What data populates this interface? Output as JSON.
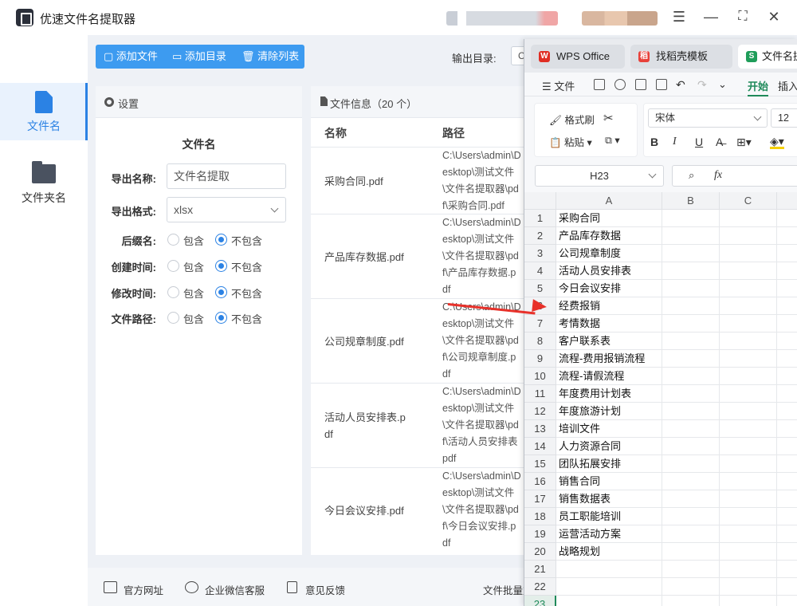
{
  "app": {
    "title": "优速文件名提取器"
  },
  "sidebar": {
    "items": [
      {
        "label": "文件名"
      },
      {
        "label": "文件夹名"
      }
    ]
  },
  "toolbar": {
    "add_file": "添加文件",
    "add_dir": "添加目录",
    "clear_list": "清除列表",
    "output_dir_label": "输出目录:",
    "output_dir_value": "C"
  },
  "settings": {
    "header": "设置",
    "section_title": "文件名",
    "export_name_label": "导出名称:",
    "export_name_value": "文件名提取",
    "export_format_label": "导出格式:",
    "export_format_value": "xlsx",
    "options": [
      {
        "label": "后缀名:",
        "include": "包含",
        "exclude": "不包含",
        "selected": "exclude"
      },
      {
        "label": "创建时间:",
        "include": "包含",
        "exclude": "不包含",
        "selected": "exclude"
      },
      {
        "label": "修改时间:",
        "include": "包含",
        "exclude": "不包含",
        "selected": "exclude"
      },
      {
        "label": "文件路径:",
        "include": "包含",
        "exclude": "不包含",
        "selected": "exclude"
      }
    ]
  },
  "file_info": {
    "header": "文件信息（20 个）",
    "col_name": "名称",
    "col_path": "路径",
    "rows": [
      {
        "name": [
          "采购合同.pdf"
        ],
        "path": [
          "C:\\Users\\admin\\D",
          "esktop\\测试文件",
          "\\文件名提取器\\pd",
          "f\\采购合同.pdf"
        ]
      },
      {
        "name": [
          "产品库存数据.pdf"
        ],
        "path": [
          "C:\\Users\\admin\\D",
          "esktop\\测试文件",
          "\\文件名提取器\\pd",
          "f\\产品库存数据.p",
          "df"
        ]
      },
      {
        "name": [
          "公司规章制度.pdf"
        ],
        "path": [
          "C:\\Users\\admin\\D",
          "esktop\\测试文件",
          "\\文件名提取器\\pd",
          "f\\公司规章制度.p",
          "df"
        ]
      },
      {
        "name": [
          "活动人员安排表.p",
          "df"
        ],
        "path": [
          "C:\\Users\\admin\\D",
          "esktop\\测试文件",
          "\\文件名提取器\\pd",
          "f\\活动人员安排表",
          "pdf"
        ]
      },
      {
        "name": [
          "今日会议安排.pdf"
        ],
        "path": [
          "C:\\Users\\admin\\D",
          "esktop\\测试文件",
          "\\文件名提取器\\pd",
          "f\\今日会议安排.p",
          "df"
        ]
      }
    ]
  },
  "footer": {
    "website": "官方网址",
    "wechat": "企业微信客服",
    "feedback": "意见反馈",
    "batch": "文件批量重"
  },
  "wps": {
    "tabs": [
      {
        "label": "WPS Office",
        "icon_color": "#e02e24"
      },
      {
        "label": "找稻壳模板",
        "icon_color": "#e8413a"
      },
      {
        "label": "文件名提",
        "icon_color": "#1f9d5a",
        "icon_letter": "S"
      }
    ],
    "menu": {
      "file": "文件",
      "start": "开始",
      "insert": "插入"
    },
    "ribbon": {
      "format_painter": "格式刷",
      "paste": "粘贴",
      "font": "宋体",
      "size": "12",
      "bold": "B",
      "italic": "I",
      "underline": "U"
    },
    "cell_ref": "H23",
    "fx": "fx",
    "columns": [
      "A",
      "B",
      "C"
    ],
    "rows": [
      {
        "num": "1",
        "a": "采购合同"
      },
      {
        "num": "2",
        "a": "产品库存数据"
      },
      {
        "num": "3",
        "a": "公司规章制度"
      },
      {
        "num": "4",
        "a": "活动人员安排表"
      },
      {
        "num": "5",
        "a": "今日会议安排"
      },
      {
        "num": "6",
        "a": "经费报销"
      },
      {
        "num": "7",
        "a": "考情数据"
      },
      {
        "num": "8",
        "a": "客户联系表"
      },
      {
        "num": "9",
        "a": "流程-费用报销流程"
      },
      {
        "num": "10",
        "a": "流程-请假流程"
      },
      {
        "num": "11",
        "a": "年度费用计划表"
      },
      {
        "num": "12",
        "a": "年度旅游计划"
      },
      {
        "num": "13",
        "a": "培训文件"
      },
      {
        "num": "14",
        "a": "人力资源合同"
      },
      {
        "num": "15",
        "a": "团队拓展安排"
      },
      {
        "num": "16",
        "a": "销售合同"
      },
      {
        "num": "17",
        "a": "销售数据表"
      },
      {
        "num": "18",
        "a": "员工职能培训"
      },
      {
        "num": "19",
        "a": "运营活动方案"
      },
      {
        "num": "20",
        "a": "战略规划"
      },
      {
        "num": "21",
        "a": ""
      },
      {
        "num": "22",
        "a": ""
      },
      {
        "num": "23",
        "a": ""
      }
    ]
  }
}
